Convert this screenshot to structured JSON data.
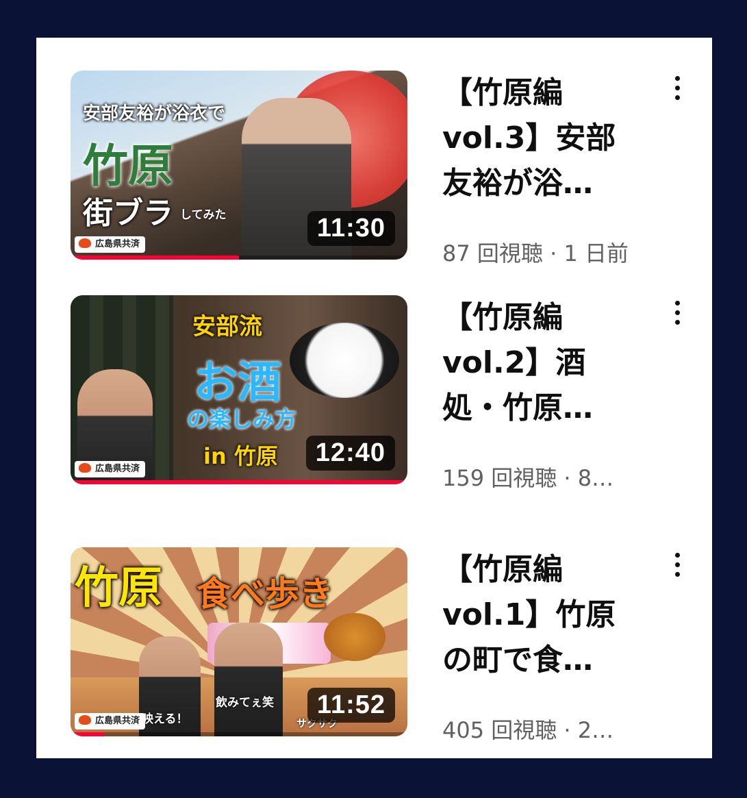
{
  "colors": {
    "background": "#0a1236",
    "card": "#ffffff",
    "progress": "#ff0033"
  },
  "videos": [
    {
      "title": "【竹原編 vol.3】安部友裕が浴…",
      "title_lines": [
        "【竹原編",
        "vol.3】安部",
        "友裕が浴…"
      ],
      "meta": "87 回視聴 · 1 日前",
      "duration": "11:30",
      "watch_progress": 0.5,
      "thumb": {
        "line1": "安部友裕が浴衣で",
        "line2": "竹原",
        "line3": "街ブラ",
        "line4": "してみた",
        "badge": "広島県共済"
      }
    },
    {
      "title": "【竹原編 vol.2】酒処・竹原…",
      "title_lines": [
        "【竹原編",
        "vol.2】酒",
        "処・竹原…"
      ],
      "meta": "159 回視聴 · 8…",
      "duration": "12:40",
      "watch_progress": 1.0,
      "thumb": {
        "line1": "安部流",
        "line2": "お酒",
        "line3": "の楽しみ方",
        "line4": "in 竹原",
        "badge": "広島県共済"
      }
    },
    {
      "title": "【竹原編 vol.1】竹原の町で食…",
      "title_lines": [
        "【竹原編",
        "vol.1】竹原",
        "の町で食…"
      ],
      "meta": "405 回視聴 · 2…",
      "duration": "11:52",
      "watch_progress": 0.1,
      "thumb": {
        "line1": "竹原",
        "line2": "食べ歩き",
        "cap1": "映える！",
        "cap2": "飲みてぇ笑",
        "cap3": "サクサク",
        "badge": "広島県共済"
      }
    }
  ]
}
